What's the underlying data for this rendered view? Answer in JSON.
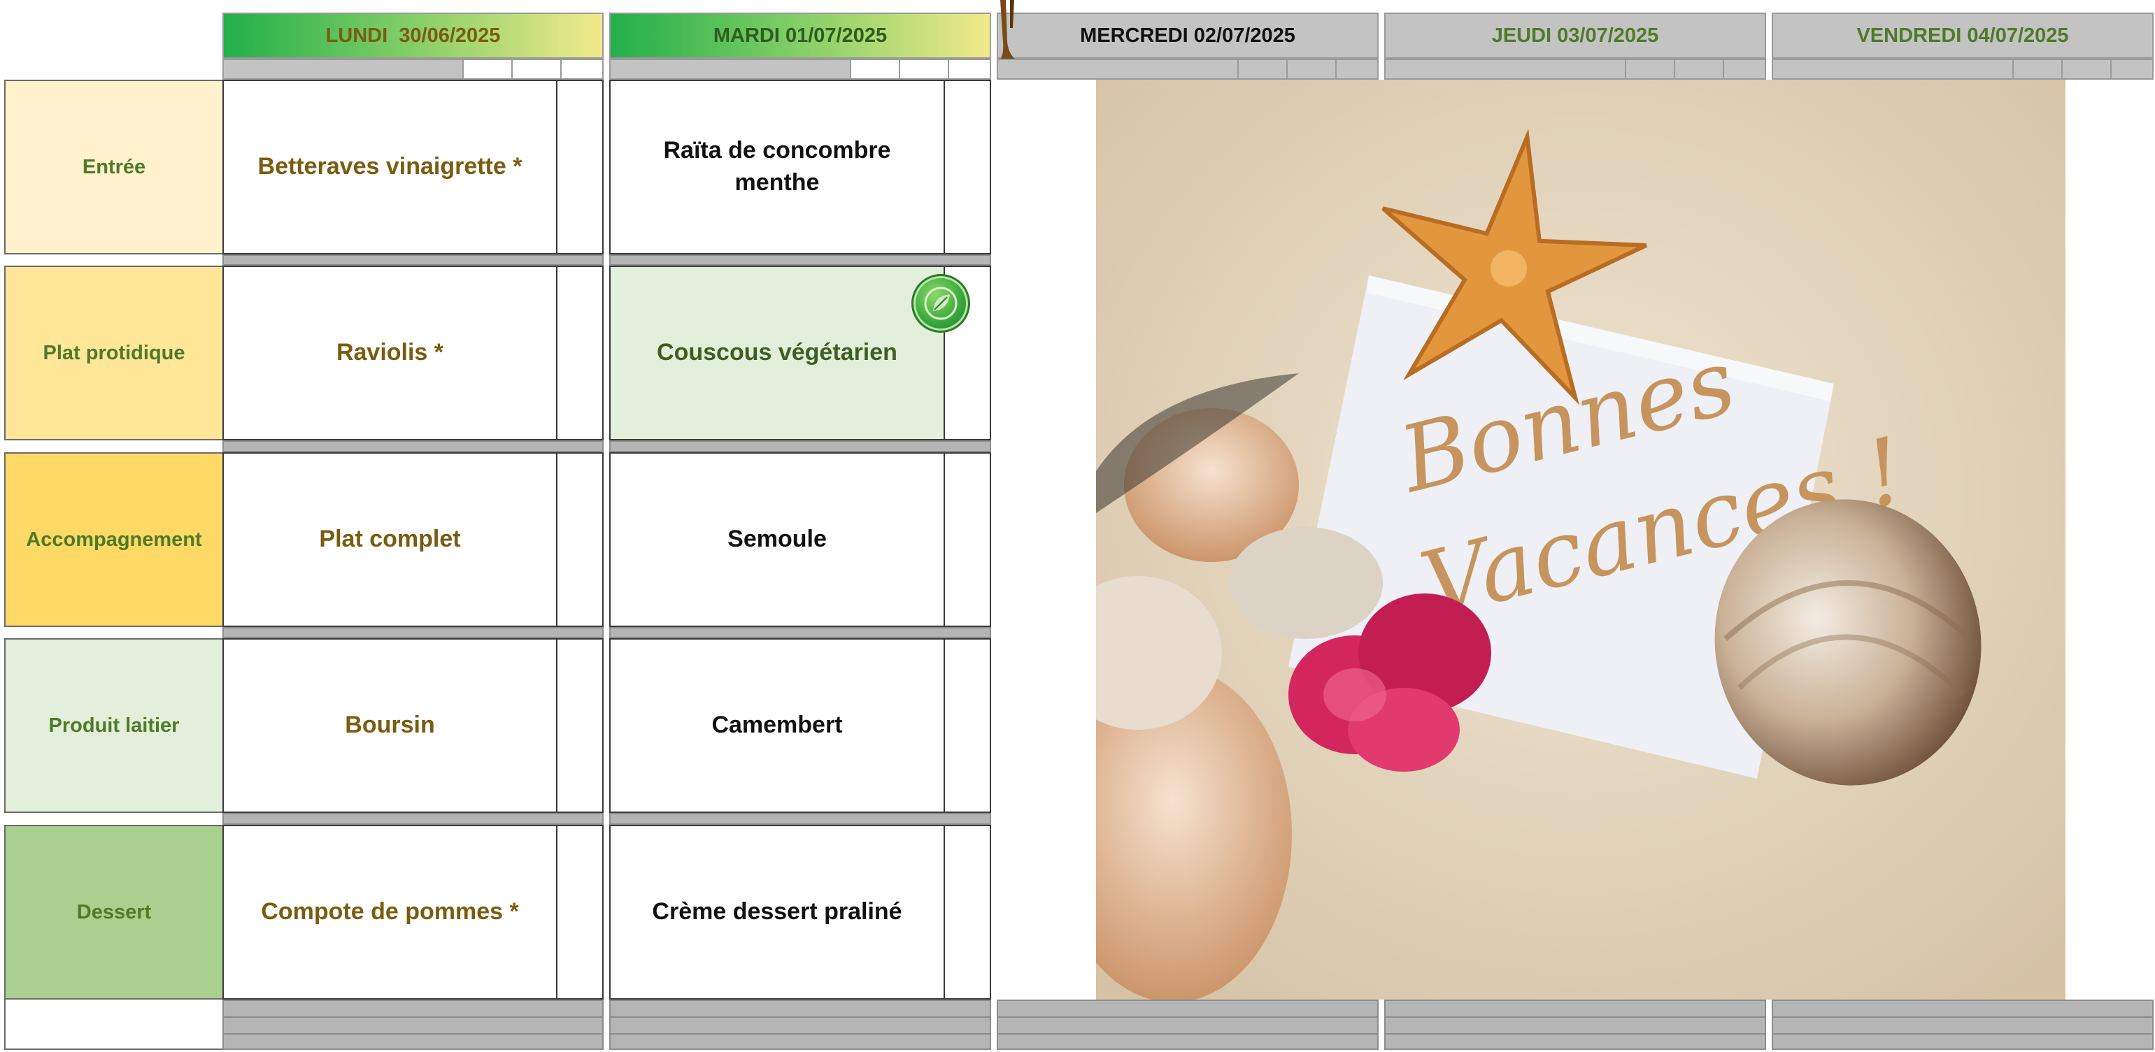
{
  "days": [
    {
      "label": "LUNDI  30/06/2025",
      "color": "#7a5c10"
    },
    {
      "label": "MARDI 01/07/2025",
      "color": "#2f5d1e"
    },
    {
      "label": "MERCREDI 02/07/2025",
      "color": "#111111"
    },
    {
      "label": "JEUDI 03/07/2025",
      "color": "#4f7a28"
    },
    {
      "label": "VENDREDI 04/07/2025",
      "color": "#4f7a28"
    }
  ],
  "categories": [
    {
      "label": "Entrée",
      "bg": "#fff2cc"
    },
    {
      "label": "Plat protidique",
      "bg": "#ffe699"
    },
    {
      "label": "Accompagnement",
      "bg": "#ffd966"
    },
    {
      "label": "Produit laitier",
      "bg": "#e2efda"
    },
    {
      "label": "Dessert",
      "bg": "#a9d08e"
    }
  ],
  "menu": {
    "lundi": [
      "Betteraves vinaigrette *",
      "Raviolis *",
      "Plat complet",
      "Boursin",
      "Compote de pommes *"
    ],
    "mardi": [
      "Raïta de concombre menthe",
      "Couscous végétarien",
      "Semoule",
      "Camembert",
      "Crème dessert praliné"
    ]
  },
  "vacation_note": {
    "line1": "Bonnes",
    "line2": "Vacances !"
  },
  "icons": {
    "vegetarian_badge": "leaf-badge-icon"
  }
}
